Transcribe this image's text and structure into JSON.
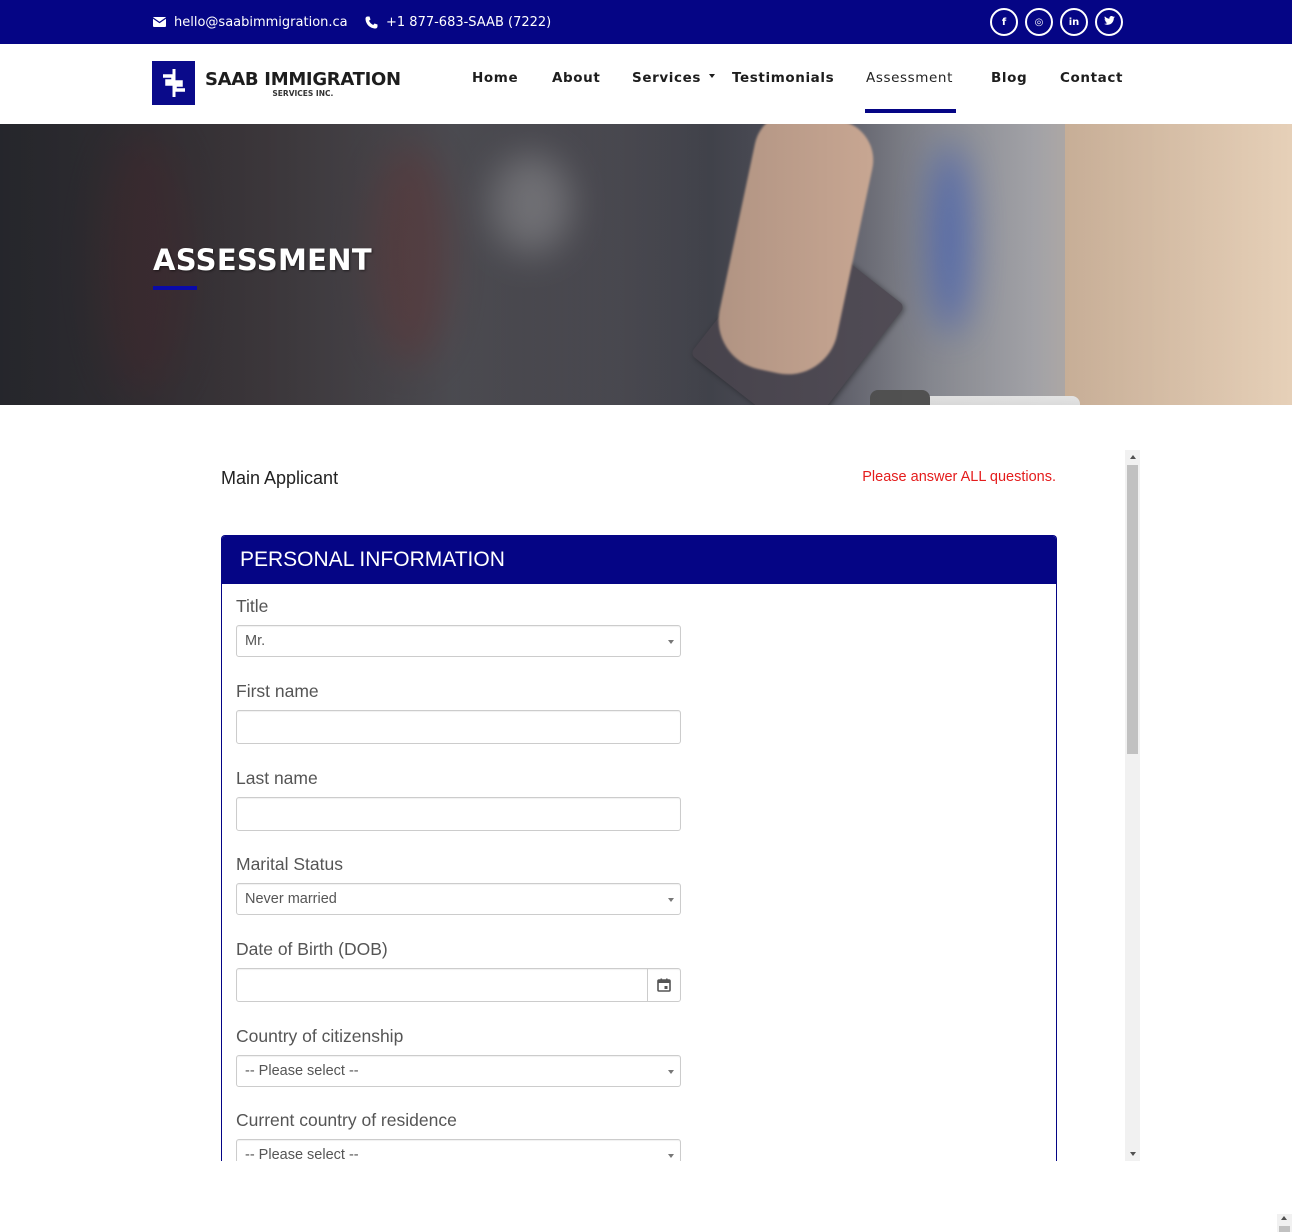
{
  "topbar": {
    "email": "hello@saabimmigration.ca",
    "phone": "+1 877-683-SAAB (7222)",
    "social": [
      {
        "name": "facebook-icon",
        "glyph": "f"
      },
      {
        "name": "instagram-icon",
        "glyph": "◎"
      },
      {
        "name": "linkedin-icon",
        "glyph": "in"
      },
      {
        "name": "twitter-icon",
        "glyph": "🐦"
      }
    ]
  },
  "brand": {
    "name": "SAAB IMMIGRATION",
    "subtitle": "SERVICES INC.",
    "mark": "$",
    "color": "#050585"
  },
  "nav": {
    "items": [
      {
        "label": "Home"
      },
      {
        "label": "About"
      },
      {
        "label": "Services",
        "has_dropdown": true
      },
      {
        "label": "Testimonials"
      },
      {
        "label": "Assessment",
        "active": true
      },
      {
        "label": "Blog"
      },
      {
        "label": "Contact"
      }
    ]
  },
  "hero": {
    "title": "ASSESSMENT"
  },
  "form": {
    "section_label": "Main Applicant",
    "warning": "Please answer ALL questions.",
    "warning_color": "#e41c1c",
    "card_title": "PERSONAL INFORMATION",
    "fields": [
      {
        "label": "Title",
        "type": "select",
        "value": "Mr."
      },
      {
        "label": "First name",
        "type": "text",
        "value": ""
      },
      {
        "label": "Last name",
        "type": "text",
        "value": ""
      },
      {
        "label": "Marital Status",
        "type": "select",
        "value": "Never married"
      },
      {
        "label": "Date of Birth (DOB)",
        "type": "date",
        "value": ""
      },
      {
        "label": "Country of citizenship",
        "type": "select",
        "value": "-- Please select --"
      },
      {
        "label": "Current country of residence",
        "type": "select",
        "value": "-- Please select --"
      }
    ]
  }
}
